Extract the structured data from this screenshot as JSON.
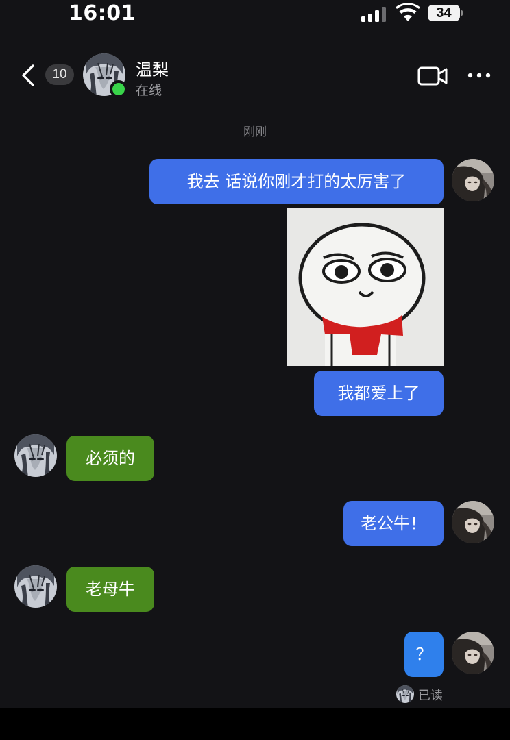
{
  "status_bar": {
    "time": "16:01",
    "battery": "34"
  },
  "header": {
    "unread_count": "10",
    "contact_name": "温梨",
    "contact_status": "在线",
    "icons": [
      "chevron-left-icon",
      "video-call-icon",
      "more-dots-icon"
    ]
  },
  "chat": {
    "timestamp": "刚刚",
    "messages": [
      {
        "from": "me",
        "type": "text",
        "text": "我去 话说你刚才打的太厉害了"
      },
      {
        "from": "me",
        "type": "sticker"
      },
      {
        "from": "me",
        "type": "text",
        "text": "我都爱上了"
      },
      {
        "from": "them",
        "type": "text",
        "text": "必须的"
      },
      {
        "from": "me",
        "type": "text",
        "text": "老公牛！"
      },
      {
        "from": "them",
        "type": "text",
        "text": "老母牛"
      },
      {
        "from": "me",
        "type": "text",
        "text": "？"
      }
    ],
    "read_label": "已读"
  },
  "colors": {
    "background": "#131316",
    "my_bubble": "#3f6fe8",
    "their_bubble": "#4a8a1e",
    "online": "#39d44a"
  }
}
